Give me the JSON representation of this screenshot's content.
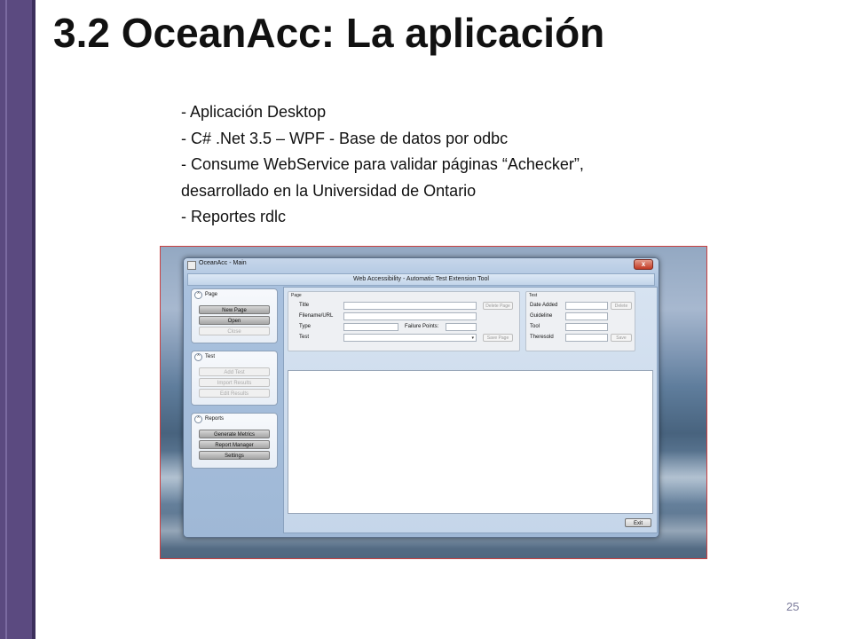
{
  "slide": {
    "title": "3.2 OceanAcc: La aplicación",
    "bullets": [
      "- Aplicación Desktop",
      "- C# .Net 3.5 – WPF - Base de datos por odbc",
      "- Consume WebService para validar páginas “Achecker”,",
      "desarrollado en la Universidad de Ontario",
      "- Reportes rdlc"
    ],
    "page_number": "25"
  },
  "app": {
    "window_title": "OceanAcc - Main",
    "close_glyph": "x",
    "banner": "Web Accessibility - Automatic Test Extension Tool",
    "panels": {
      "page": {
        "title": "Page",
        "buttons": [
          "New Page",
          "Open",
          "Close"
        ]
      },
      "test": {
        "title": "Test",
        "buttons": [
          "Add Test",
          "Import Results",
          "Edit Results"
        ]
      },
      "reports": {
        "title": "Reports",
        "buttons": [
          "Generate Metrics",
          "Report Manager",
          "Settings"
        ]
      }
    },
    "page_group": {
      "title": "Page",
      "labels": {
        "title": "Title",
        "filename": "Filename/URL",
        "type": "Type",
        "failure_points": "Failure Points:",
        "test": "Test"
      },
      "buttons": {
        "delete": "Delete Page",
        "save": "Save Page"
      }
    },
    "test_group": {
      "title": "Test",
      "labels": {
        "date_added": "Date Added",
        "guideline": "Guideline",
        "tool": "Tool",
        "theresold": "Theresold"
      },
      "buttons": {
        "delete": "Delete",
        "save": "Save"
      }
    },
    "exit_label": "Exit"
  },
  "icons": {
    "chevron": "chevron-up-icon",
    "combo_arrow": "▾"
  }
}
